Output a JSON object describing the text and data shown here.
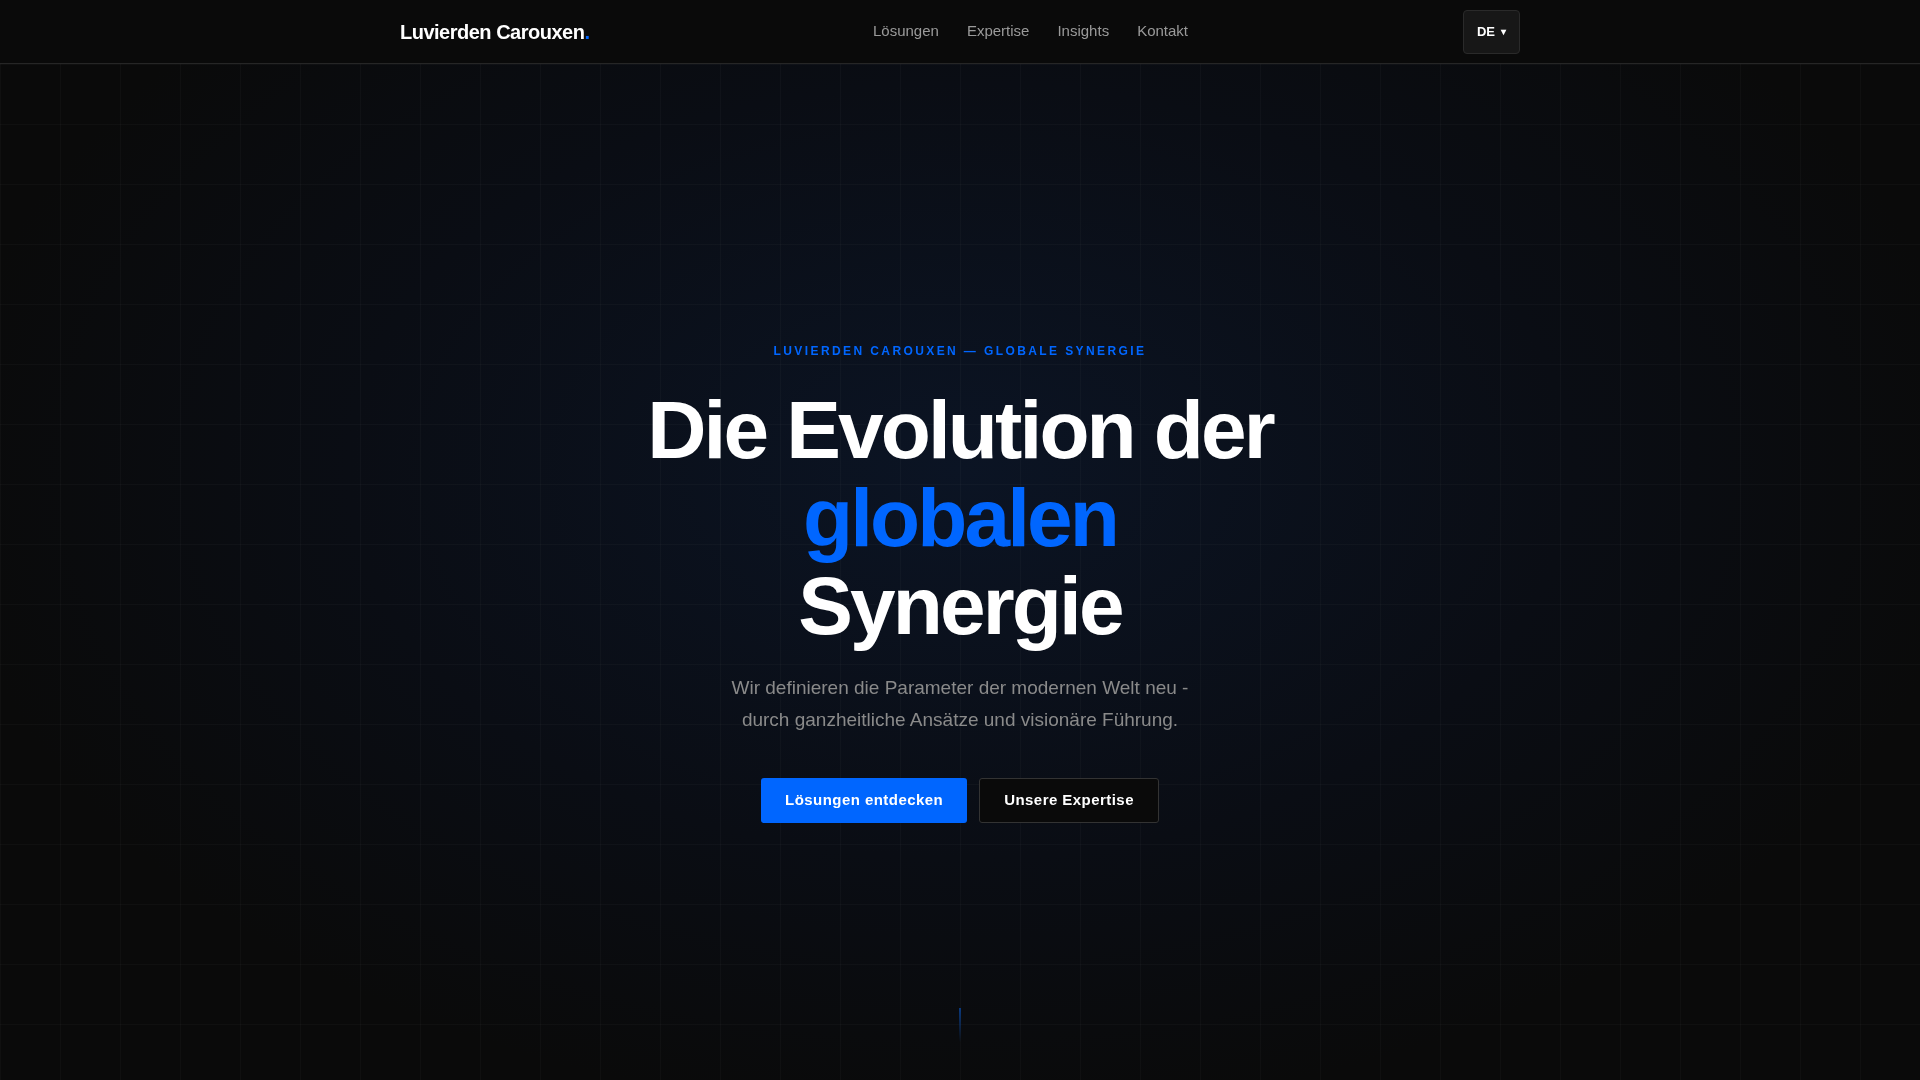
{
  "header": {
    "logo": "Luvierden Carouxen",
    "logo_dot": ".",
    "nav": [
      "Lösungen",
      "Expertise",
      "Insights",
      "Kontakt"
    ],
    "language": {
      "label": "DE",
      "caret": "▾"
    }
  },
  "hero": {
    "eyebrow": "LUVIERDEN CAROUXEN — GLOBALE SYNERGIE",
    "headline": [
      {
        "text": "Die Evolution der",
        "accent": false
      },
      {
        "text": "globalen",
        "accent": true
      },
      {
        "text": "Synergie",
        "accent": false
      }
    ],
    "subtitle": [
      "Wir definieren die Parameter der modernen Welt neu -",
      "durch ganzheitliche Ansätze und visionäre Führung."
    ],
    "buttons": [
      {
        "label": "Lösungen entdecken",
        "kind": "primary"
      },
      {
        "label": "Unsere Expertise",
        "kind": "outline"
      }
    ]
  }
}
